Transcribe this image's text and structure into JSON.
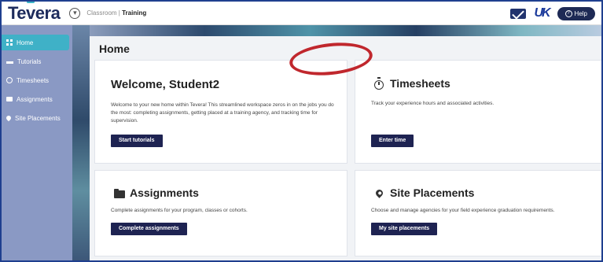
{
  "header": {
    "logo_text": "Tevera",
    "breadcrumb_parent": "Classroom",
    "breadcrumb_sep": " | ",
    "breadcrumb_current": "Training",
    "uk_logo": "UK",
    "help_label": "Help"
  },
  "sidebar": {
    "items": [
      {
        "label": "Home",
        "icon": "grid-icon",
        "active": true
      },
      {
        "label": "Tutorials",
        "icon": "graduation-cap-icon"
      },
      {
        "label": "Timesheets",
        "icon": "clock-icon"
      },
      {
        "label": "Assignments",
        "icon": "folder-icon"
      },
      {
        "label": "Site Placements",
        "icon": "map-pin-icon"
      }
    ]
  },
  "main": {
    "page_title": "Home",
    "cards": {
      "welcome": {
        "title": "Welcome, Student2",
        "body": "Welcome to your new home within Tevera! This streamlined workspace zeros in on the jobs you do the most: completing assignments, getting placed at a training agency, and tracking time for supervision.",
        "button": "Start tutorials"
      },
      "timesheets": {
        "title": "Timesheets",
        "body": "Track your experience hours and associated activities.",
        "button": "Enter time"
      },
      "assignments": {
        "title": "Assignments",
        "body": "Complete assignments for your program, classes or cohorts.",
        "button": "Complete assignments"
      },
      "placements": {
        "title": "Site Placements",
        "body": "Choose and manage agencies for your field experience graduation requirements.",
        "button": "My site placements"
      }
    }
  },
  "colors": {
    "sidebar_bg": "#8a99c4",
    "active_item": "#3fb1c7",
    "button_bg": "#1e2352",
    "highlight_ring": "#c0272d"
  }
}
